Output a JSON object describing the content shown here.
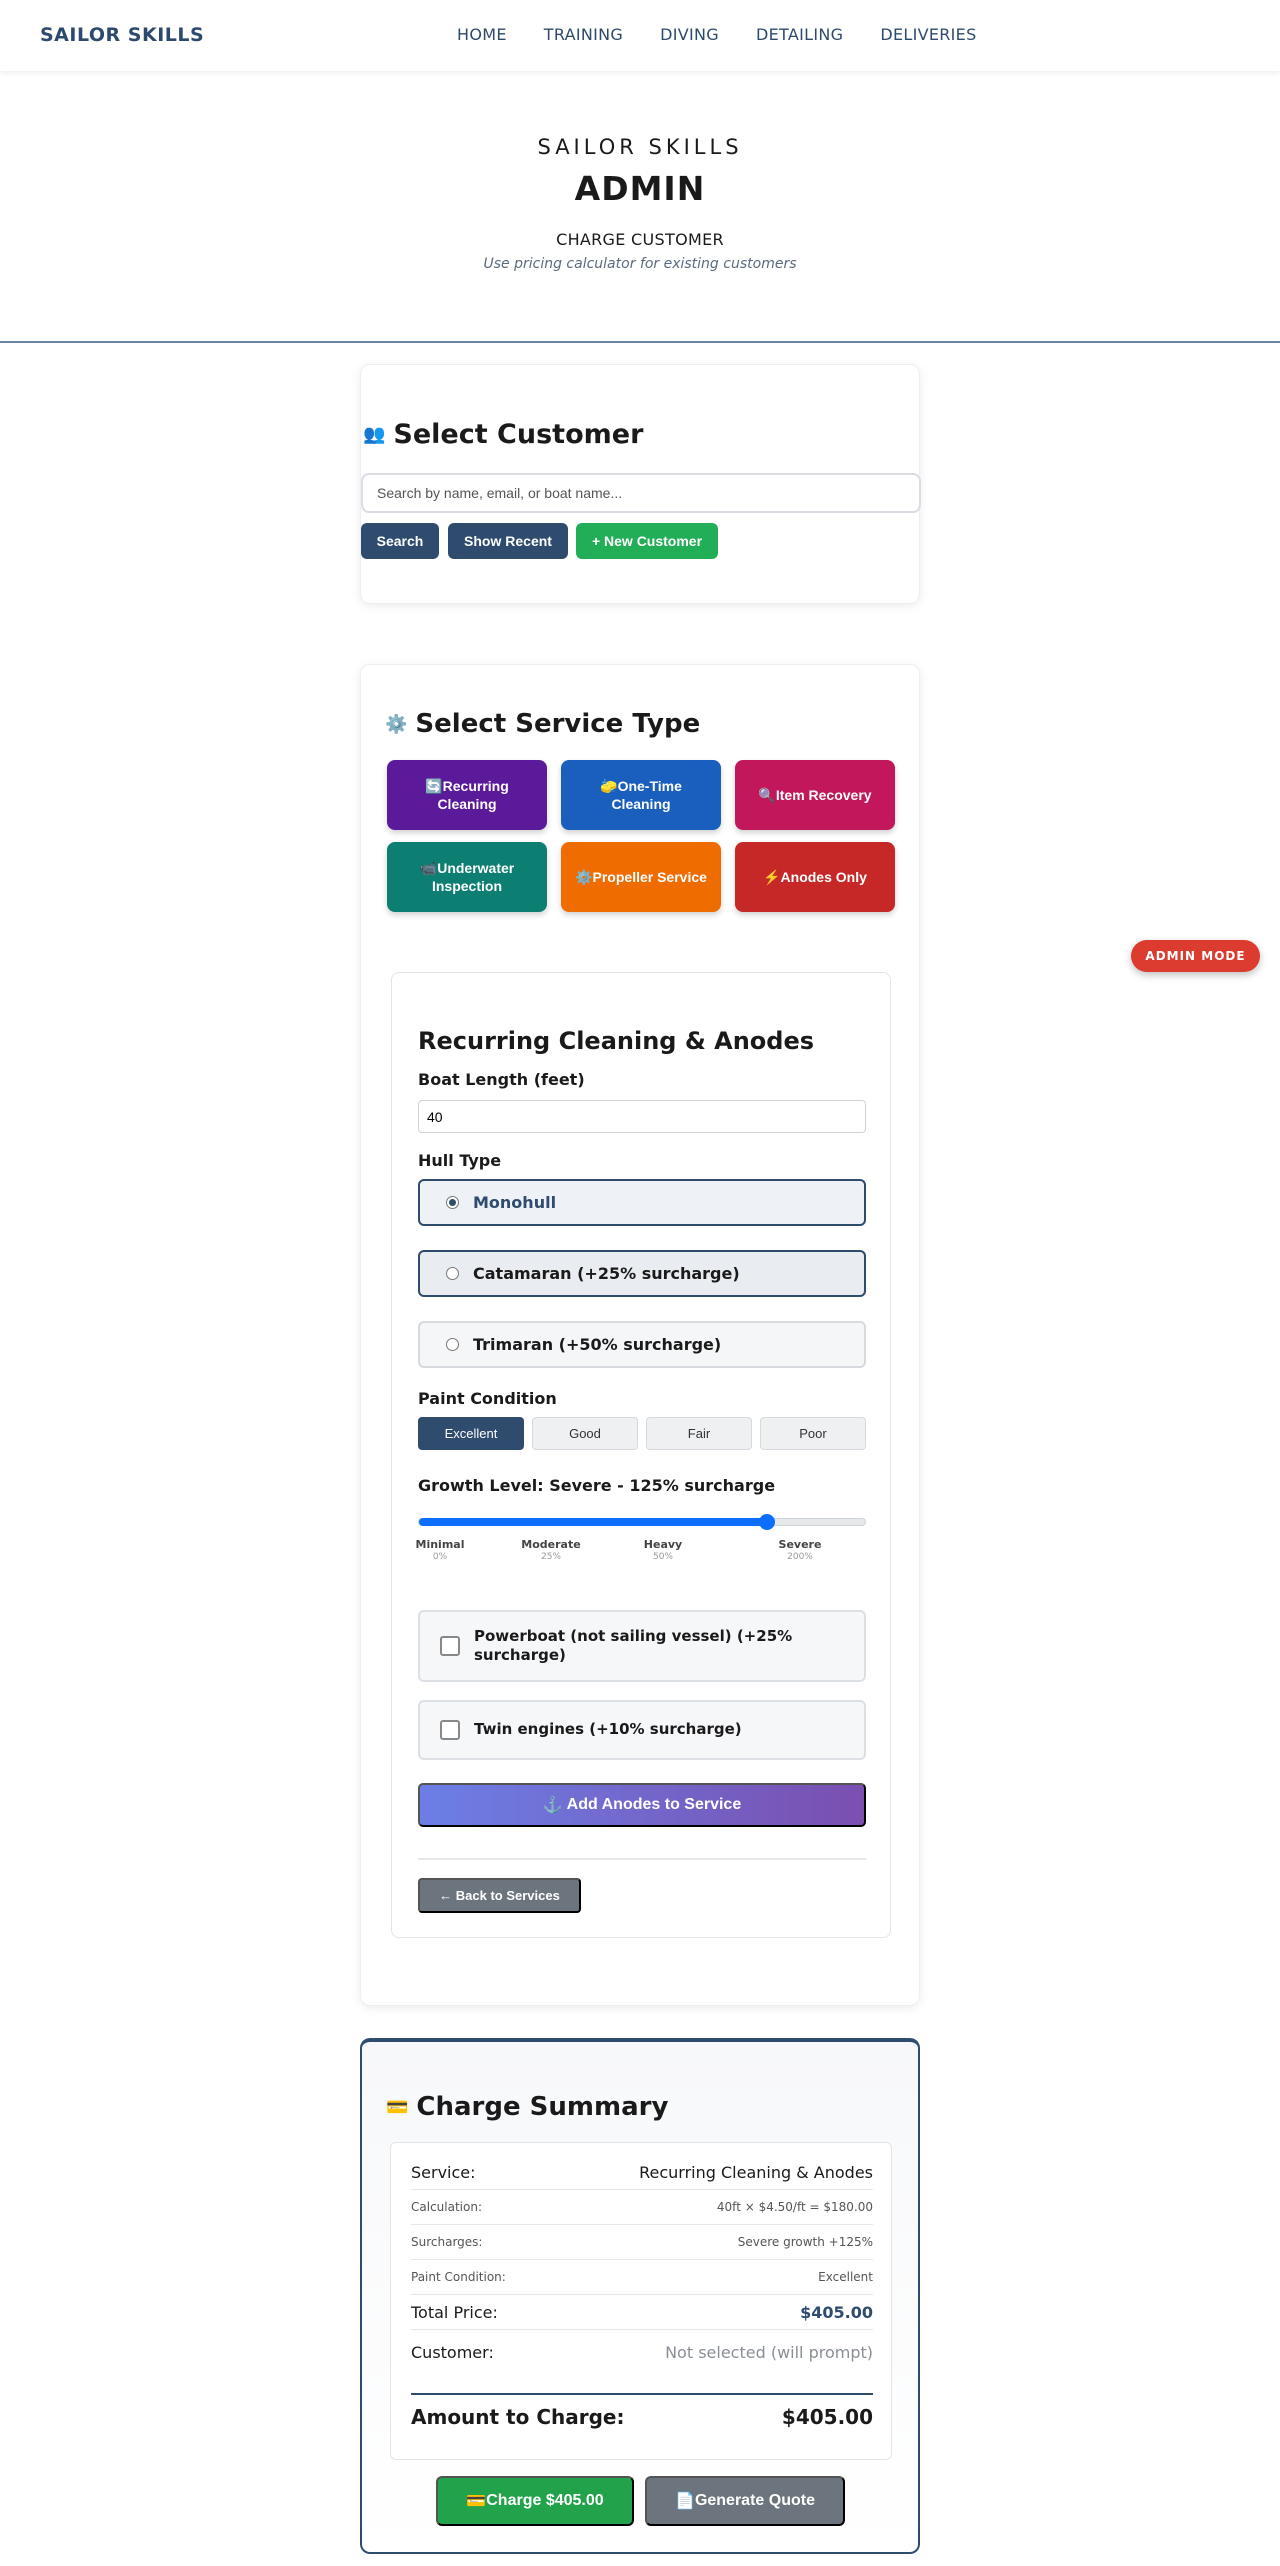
{
  "nav": {
    "brand": "SAILOR SKILLS",
    "links": [
      "HOME",
      "TRAINING",
      "DIVING",
      "DETAILING",
      "DELIVERIES"
    ]
  },
  "hero": {
    "brand": "SAILOR SKILLS",
    "title": "ADMIN",
    "subtitle": "CHARGE CUSTOMER",
    "note": "Use pricing calculator for existing customers"
  },
  "customer": {
    "icon": "👥",
    "title": "Select Customer",
    "search_placeholder": "Search by name, email, or boat name...",
    "search_label": "Search",
    "recent_label": "Show Recent",
    "new_label": "+ New Customer"
  },
  "service": {
    "icon": "⚙️",
    "title": "Select Service Type",
    "types": [
      {
        "icon": "🔄",
        "label": "Recurring Cleaning",
        "color": "#5a1a9a"
      },
      {
        "icon": "🧽",
        "label": "One-Time Cleaning",
        "color": "#1a5fbd"
      },
      {
        "icon": "🔍",
        "label": "Item Recovery",
        "color": "#c2185b"
      },
      {
        "icon": "📹",
        "label": "Underwater Inspection",
        "color": "#0c7f72"
      },
      {
        "icon": "⚙️",
        "label": "Propeller Service",
        "color": "#ef6c00"
      },
      {
        "icon": "⚡",
        "label": "Anodes Only",
        "color": "#c62828"
      }
    ]
  },
  "form": {
    "title": "Recurring Cleaning & Anodes",
    "boat_length_label": "Boat Length (feet)",
    "boat_length_value": "40",
    "hull_label": "Hull Type",
    "hull_options": [
      "Monohull",
      "Catamaran (+25% surcharge)",
      "Trimaran (+50% surcharge)"
    ],
    "hull_selected": "Monohull",
    "paint_label": "Paint Condition",
    "paint_options": [
      "Excellent",
      "Good",
      "Fair",
      "Poor"
    ],
    "paint_selected": "Excellent",
    "growth_label": "Growth Level: Severe - 125% surcharge",
    "growth_ticks": [
      {
        "name": "Minimal",
        "pct": "0%"
      },
      {
        "name": "Moderate",
        "pct": "25%"
      },
      {
        "name": "Heavy",
        "pct": "50%"
      },
      {
        "name": "Severe",
        "pct": "200%"
      }
    ],
    "growth_level_fraction": 0.78,
    "powerboat_label": "Powerboat (not sailing vessel) (+25% surcharge)",
    "twin_label": "Twin engines (+10% surcharge)",
    "anodes_label": "Add Anodes to Service",
    "anodes_icon": "⚓",
    "back_label": "← Back to Services"
  },
  "admin_badge": "ADMIN MODE",
  "summary": {
    "icon": "💳",
    "title": "Charge Summary",
    "rows": [
      {
        "k": "Service:",
        "v": "Recurring Cleaning & Anodes"
      },
      {
        "k": "Calculation:",
        "v": "40ft × $4.50/ft = $180.00"
      },
      {
        "k": "Surcharges:",
        "v": "Severe growth +125%"
      },
      {
        "k": "Paint Condition:",
        "v": "Excellent"
      },
      {
        "k": "Total Price:",
        "v": "$405.00"
      },
      {
        "k": "Customer:",
        "v": "Not selected (will prompt)"
      }
    ],
    "amount_label": "Amount to Charge:",
    "amount_value": "$405.00",
    "charge_icon": "💳",
    "charge_label": "Charge $405.00",
    "quote_icon": "📄",
    "quote_label": "Generate Quote"
  },
  "colors": {
    "navy": "#2f4b6e",
    "green": "#22ae57",
    "admin_red": "#dc3b30",
    "slider_blue": "#0d6efd"
  }
}
